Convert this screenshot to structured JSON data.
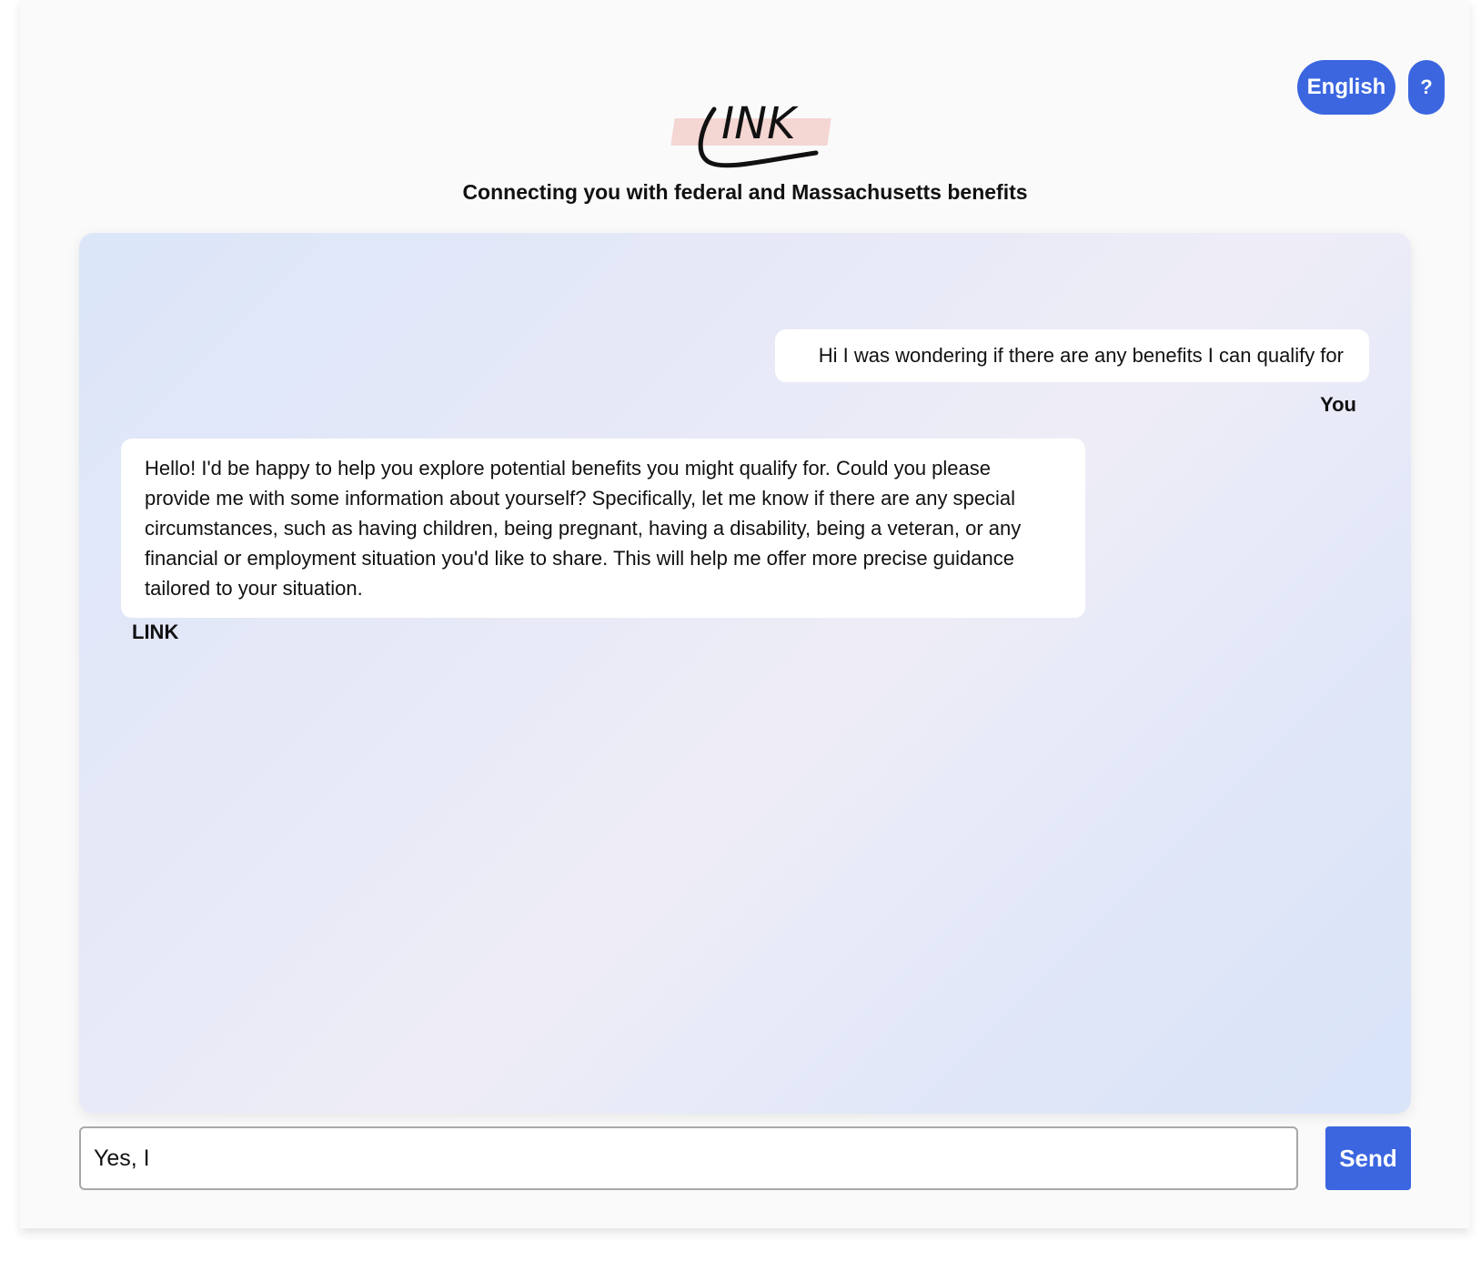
{
  "header": {
    "language_label": "English",
    "help_label": "?",
    "logo_text": "LINK",
    "tagline": "Connecting you with federal and Massachusetts benefits"
  },
  "chat": {
    "messages": [
      {
        "sender": "You",
        "text": "Hi I was wondering if there are any benefits I can qualify for"
      },
      {
        "sender": "LINK",
        "text": "Hello! I'd be happy to help you explore potential benefits you might qualify for. Could you please provide me with some information about yourself? Specifically, let me know if there are any special circumstances, such as having children, being pregnant, having a disability, being a veteran, or any financial or employment situation you'd like to share. This will help me offer more precise guidance tailored to your situation."
      }
    ]
  },
  "composer": {
    "input_value": "Yes, I",
    "send_label": "Send"
  },
  "colors": {
    "accent": "#3b66e0",
    "logo_highlight": "#f4d6d2"
  }
}
